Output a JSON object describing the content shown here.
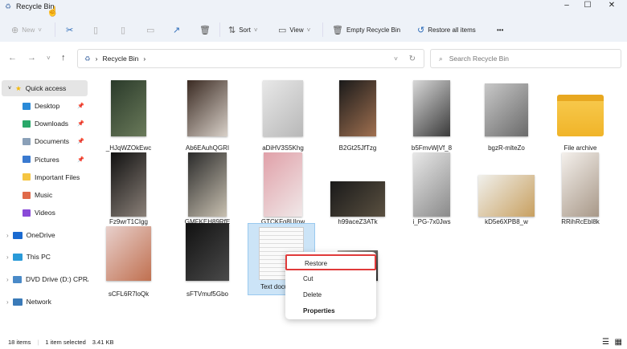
{
  "window": {
    "title": "Recycle Bin",
    "minimize": "–",
    "maximize": "☐",
    "close": "✕"
  },
  "toolbar": {
    "new": "New",
    "sort": "Sort",
    "view": "View",
    "empty": "Empty Recycle Bin",
    "restore_all": "Restore all items",
    "more": "•••"
  },
  "address": {
    "path": "Recycle Bin",
    "search_placeholder": "Search Recycle Bin"
  },
  "sidebar": {
    "quick_access": "Quick access",
    "items": [
      {
        "label": "Desktop",
        "pinned": true,
        "color": "#2a8ad8"
      },
      {
        "label": "Downloads",
        "pinned": true,
        "color": "#2aa86a"
      },
      {
        "label": "Documents",
        "pinned": true,
        "color": "#8aa0b8"
      },
      {
        "label": "Pictures",
        "pinned": true,
        "color": "#3a7ad0"
      },
      {
        "label": "Important Files",
        "pinned": false,
        "color": "#f5c542"
      },
      {
        "label": "Music",
        "pinned": false,
        "color": "#e06a4a"
      },
      {
        "label": "Videos",
        "pinned": false,
        "color": "#8a4ad8"
      }
    ],
    "roots": [
      {
        "label": "OneDrive",
        "color": "#1a6ad0"
      },
      {
        "label": "This PC",
        "color": "#2a9ad8"
      },
      {
        "label": "DVD Drive (D:) CPRA",
        "color": "#4a8ac8"
      },
      {
        "label": "Network",
        "color": "#3a7ab8"
      }
    ]
  },
  "files": [
    {
      "name": "_HJqWZOkEwc",
      "c1": "#2a3a2a",
      "c2": "#6a7a5a"
    },
    {
      "name": "Ab6EAuhQGRI",
      "c1": "#3a2a22",
      "c2": "#d8d0c8"
    },
    {
      "name": "aDiHV3S5Khg",
      "c1": "#e8e8e8",
      "c2": "#b8b8b8"
    },
    {
      "name": "B2Gt25JfTzg",
      "c1": "#1a1a1a",
      "c2": "#a07050"
    },
    {
      "name": "b5FmvWjVf_8",
      "c1": "#d8d8d8",
      "c2": "#3a3a3a"
    },
    {
      "name": "bgzR-mlteZo",
      "c1": "#c8c8c8",
      "c2": "#6a6a6a"
    },
    {
      "name": "File archive",
      "folder": true
    },
    {
      "name": "Fz9wrT1CIgg",
      "c1": "#111",
      "c2": "#8a8078"
    },
    {
      "name": "GMFKEH89RfE",
      "c1": "#2a2a2a",
      "c2": "#c8c0b0"
    },
    {
      "name": "GTCKFq8UInw",
      "c1": "#e0a0a8",
      "c2": "#f0e8e8"
    },
    {
      "name": "h99aceZ3ATk",
      "c1": "#1a1a1a",
      "c2": "#5a5040"
    },
    {
      "name": "i_PG-7x0Jws",
      "c1": "#e8e8e8",
      "c2": "#8a8a8a"
    },
    {
      "name": "kD5e6XPB8_w",
      "c1": "#f0f0ec",
      "c2": "#c8a060"
    },
    {
      "name": "RRihRcEbl8k",
      "c1": "#f4f0ec",
      "c2": "#a89888"
    },
    {
      "name": "sCFL6R7loQk",
      "c1": "#e8d0cc",
      "c2": "#c07050"
    },
    {
      "name": "sFTVmuf5Gbo",
      "c1": "#111",
      "c2": "#4a4a4a"
    },
    {
      "name": "Text document",
      "doc": true,
      "selected": true
    },
    {
      "name": "",
      "c1": "#b0a8a0",
      "c2": "#2a2a2a"
    }
  ],
  "context_menu": {
    "items": [
      "Restore",
      "Cut",
      "Delete",
      "Properties"
    ],
    "highlight": "#e03a3a"
  },
  "status": {
    "count": "18 items",
    "selected": "1 item selected",
    "size": "3.41 KB"
  }
}
